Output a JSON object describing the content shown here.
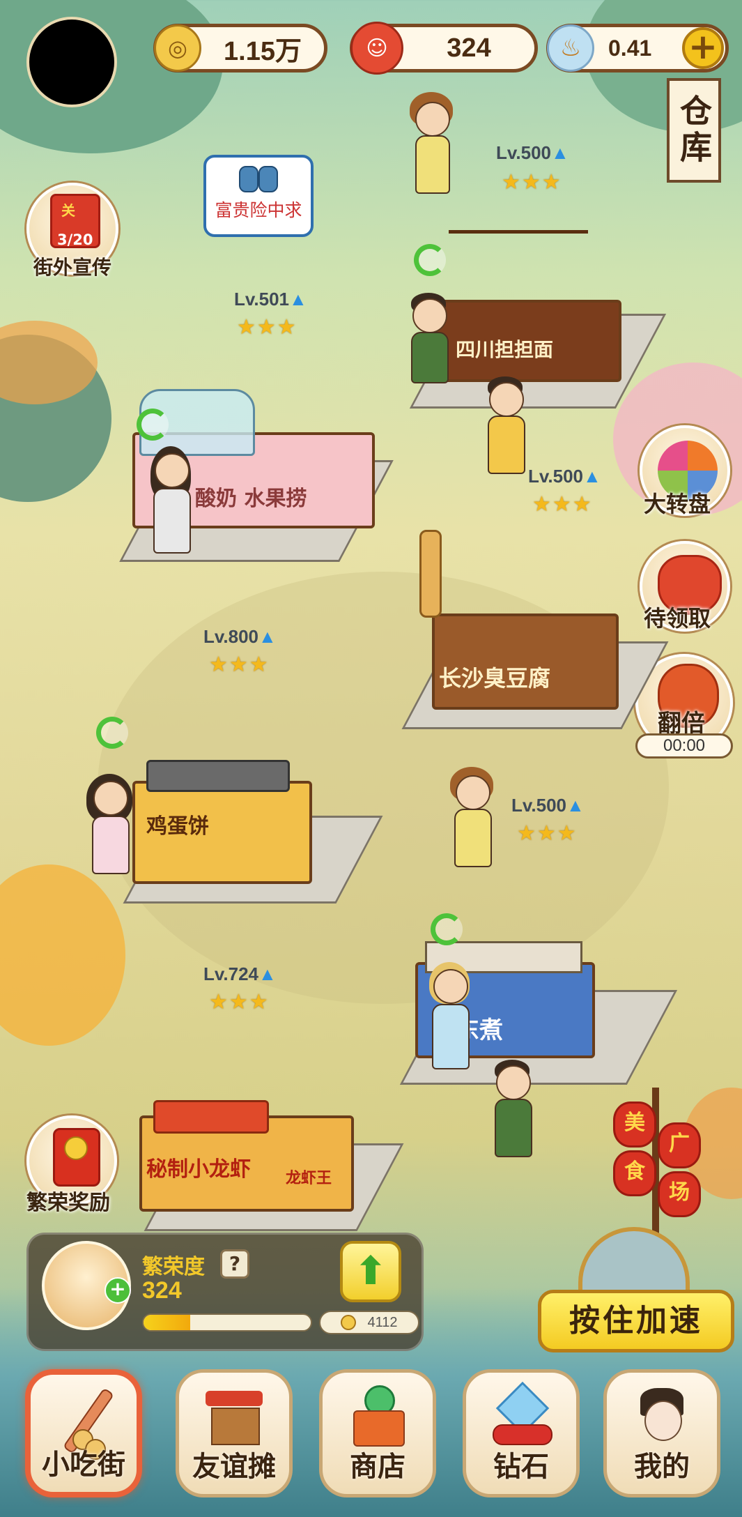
{
  "resources": {
    "coins": "1.15万",
    "cats": "324",
    "diamonds": "0.41",
    "add_symbol": "+"
  },
  "warehouse": "仓库",
  "side_left": {
    "promo": {
      "counter": "3/20",
      "label": "街外宣传",
      "badge": "关"
    },
    "reward": {
      "label": "繁荣奖励"
    }
  },
  "side_right": {
    "wheel": "大转盘",
    "pending": "待领取",
    "double": "翻倍",
    "double_timer": "00:00"
  },
  "tooltip": {
    "label": "富贵险中求"
  },
  "stalls": [
    {
      "level": "Lv.501",
      "stars": "★★★",
      "sign": "酸奶 水果捞"
    },
    {
      "level": "Lv.500",
      "stars": "★★★",
      "sign": "四川担担面"
    },
    {
      "level": "Lv.500",
      "stars": "★★★",
      "sign": "长沙臭豆腐"
    },
    {
      "level": "Lv.800",
      "stars": "★★★",
      "sign": "鸡蛋饼"
    },
    {
      "level": "Lv.500",
      "stars": "★★★",
      "sign": "关东煮"
    },
    {
      "level": "Lv.724",
      "stars": "★★★",
      "sign": "秘制小龙虾"
    }
  ],
  "stall_sub": {
    "lobster": "龙虾王"
  },
  "plaza": [
    "美",
    "食",
    "广",
    "场"
  ],
  "prosperity": {
    "label": "繁荣度",
    "value": "324",
    "help": "?",
    "cost": "4112",
    "progress_fraction": 0.28
  },
  "speed_button": "按住加速",
  "nav": [
    {
      "label": "小吃街",
      "active": true
    },
    {
      "label": "友谊摊",
      "active": false
    },
    {
      "label": "商店",
      "active": false
    },
    {
      "label": "钻石",
      "active": false
    },
    {
      "label": "我的",
      "active": false
    }
  ],
  "colors": {
    "accent": "#f4cb22",
    "active_nav": "#e9623a",
    "level_up": "#2b8fe0",
    "star": "#f4b91c"
  }
}
